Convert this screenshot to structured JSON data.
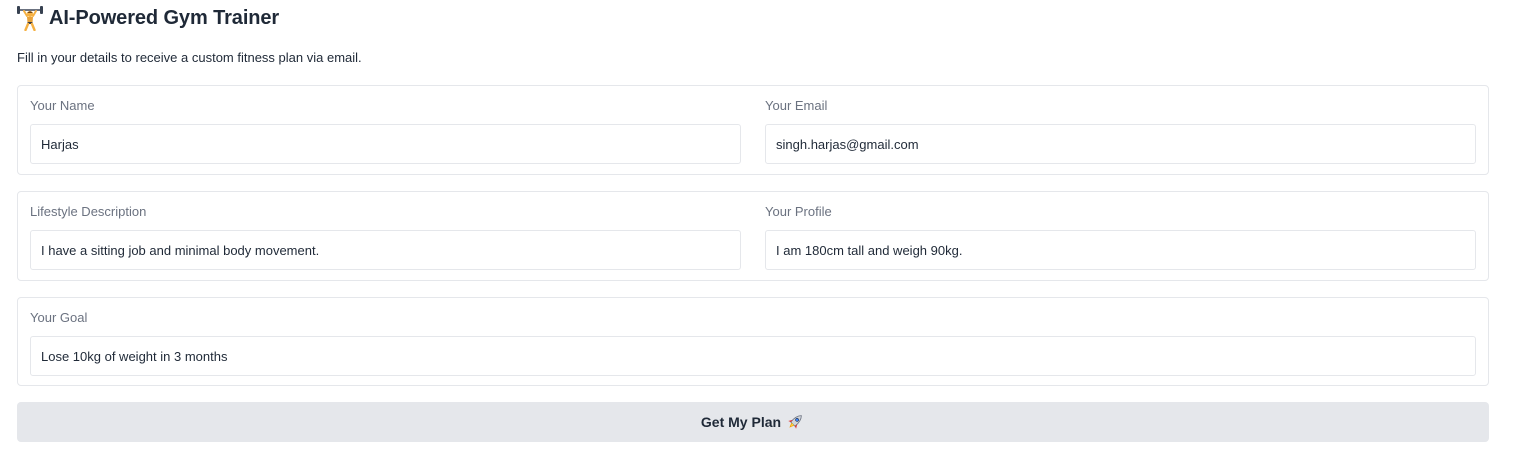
{
  "header": {
    "title": "AI-Powered Gym Trainer",
    "icon": "weightlifter-icon",
    "subtitle": "Fill in your details to receive a custom fitness plan via email."
  },
  "form": {
    "name": {
      "label": "Your Name",
      "value": "Harjas"
    },
    "email": {
      "label": "Your Email",
      "value": "singh.harjas@gmail.com"
    },
    "lifestyle": {
      "label": "Lifestyle Description",
      "value": "I have a sitting job and minimal body movement."
    },
    "profile": {
      "label": "Your Profile",
      "value": "I am 180cm tall and weigh 90kg."
    },
    "goal": {
      "label": "Your Goal",
      "value": "Lose 10kg of weight in 3 months"
    }
  },
  "submit": {
    "label": "Get My Plan",
    "icon": "rocket-icon"
  },
  "colors": {
    "border": "#e5e7eb",
    "label": "#6b7280",
    "text": "#1f2937",
    "button_bg": "#e5e7eb"
  }
}
